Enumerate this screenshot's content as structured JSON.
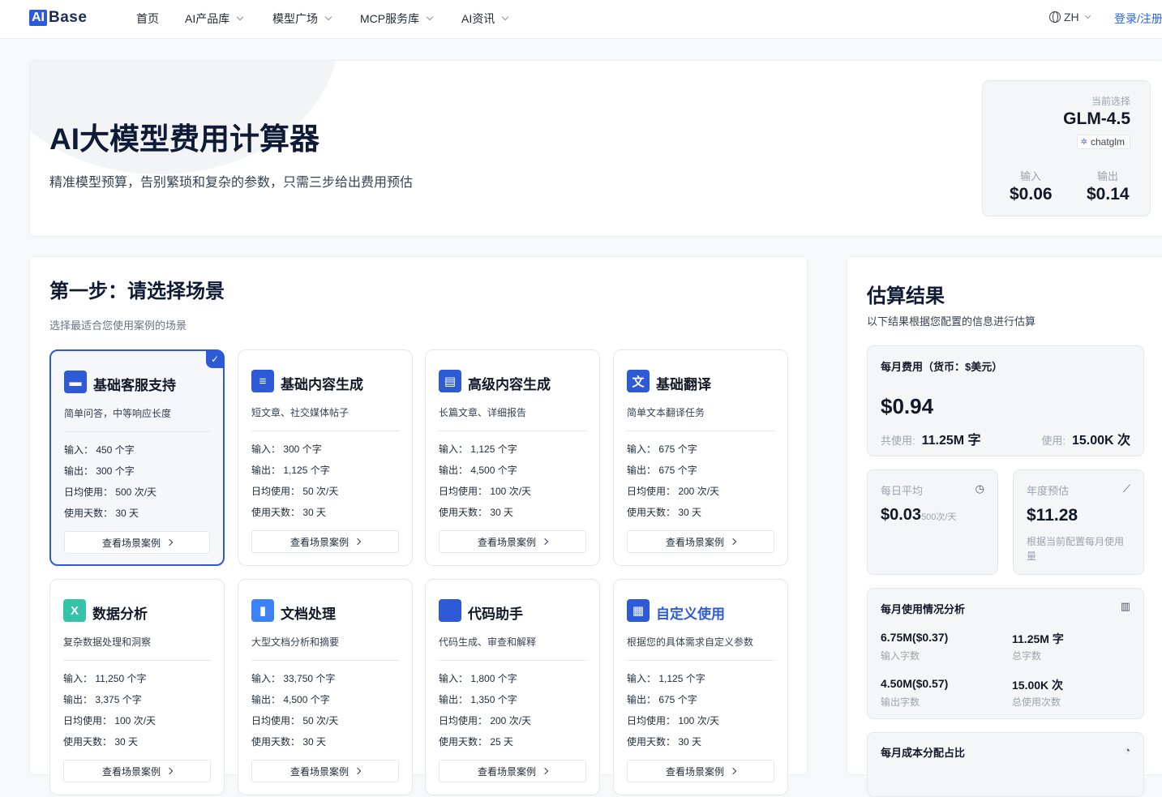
{
  "nav": {
    "logo_ai": "AI",
    "logo_base": "Base",
    "items": [
      "首页",
      "AI产品库",
      "模型广场",
      "MCP服务库",
      "AI资讯"
    ],
    "lang": "ZH",
    "login": "登录/注册"
  },
  "hero": {
    "title": "AI大模型费用计算器",
    "subtitle": "精准模型预算，告别繁琐和复杂的参数，只需三步给出费用预估"
  },
  "selection": {
    "label": "当前选择",
    "model": "GLM-4.5",
    "provider": "chatglm",
    "input_label": "输入",
    "input_price": "$0.06",
    "output_label": "输出",
    "output_price": "$0.14"
  },
  "step1": {
    "title": "第一步：请选择场景",
    "desc": "选择最适合您使用案例的场景",
    "button_label": "查看场景案例",
    "cards": [
      {
        "title": "基础客服支持",
        "desc": "简单问答，中等响应长度",
        "input": "输入： 450 个字",
        "output": "输出： 300 个字",
        "daily": "日均使用： 500 次/天",
        "days": "使用天数： 30 天",
        "selected": true,
        "icon": "chat-icon",
        "color": "#2d5bd7"
      },
      {
        "title": "基础内容生成",
        "desc": "短文章、社交媒体帖子",
        "input": "输入： 300 个字",
        "output": "输出： 1,125 个字",
        "daily": "日均使用： 50 次/天",
        "days": "使用天数： 30 天",
        "selected": false,
        "icon": "text-lines-icon",
        "color": "#2d5bd7"
      },
      {
        "title": "高级内容生成",
        "desc": "长篇文章、详细报告",
        "input": "输入： 1,125 个字",
        "output": "输出： 4,500 个字",
        "daily": "日均使用： 100 次/天",
        "days": "使用天数： 30 天",
        "selected": false,
        "icon": "document-star-icon",
        "color": "#2d5bd7"
      },
      {
        "title": "基础翻译",
        "desc": "简单文本翻译任务",
        "input": "输入： 675 个字",
        "output": "输出： 675 个字",
        "daily": "日均使用： 200 次/天",
        "days": "使用天数： 30 天",
        "selected": false,
        "icon": "translate-icon",
        "color": "#2d5bd7"
      },
      {
        "title": "数据分析",
        "desc": "复杂数据处理和洞察",
        "input": "输入： 11,250 个字",
        "output": "输出： 3,375 个字",
        "daily": "日均使用： 100 次/天",
        "days": "使用天数： 30 天",
        "selected": false,
        "icon": "excel-icon",
        "color": "#34c3a8"
      },
      {
        "title": "文档处理",
        "desc": "大型文档分析和摘要",
        "input": "输入： 33,750 个字",
        "output": "输出： 4,500 个字",
        "daily": "日均使用： 50 次/天",
        "days": "使用天数： 30 天",
        "selected": false,
        "icon": "book-icon",
        "color": "#3b82f6"
      },
      {
        "title": "代码助手",
        "desc": "代码生成、审查和解释",
        "input": "输入： 1,800 个字",
        "output": "输出： 1,350 个字",
        "daily": "日均使用： 200 次/天",
        "days": "使用天数： 25 天",
        "selected": false,
        "icon": "code-icon",
        "color": "#2d5bd7"
      },
      {
        "title": "自定义使用",
        "desc": "根据您的具体需求自定义参数",
        "input": "输入： 1,125 个字",
        "output": "输出： 675 个字",
        "daily": "日均使用： 100 次/天",
        "days": "使用天数： 30 天",
        "selected": false,
        "icon": "grid-icon",
        "color": "#2d5bd7"
      }
    ]
  },
  "result": {
    "title": "估算结果",
    "desc": "以下结果根据您配置的信息进行估算",
    "monthly_label": "每月费用（货币：$美元）",
    "monthly_cost": "$0.94",
    "total_label": "共使用:",
    "total_value": "11.25M 字",
    "usage_label": "使用:",
    "usage_value": "15.00K 次",
    "daily_label": "每日平均",
    "daily_value": "$0.03",
    "daily_unit": "500次/天",
    "yearly_label": "年度预估",
    "yearly_value": "$11.28",
    "yearly_note": "根据当前配置每月使用量",
    "analysis_title": "每月使用情况分析",
    "analysis": [
      {
        "value": "6.75M($0.37)",
        "label": "输入字数"
      },
      {
        "value": "11.25M 字",
        "label": "总字数"
      },
      {
        "value": "4.50M($0.57)",
        "label": "输出字数"
      },
      {
        "value": "15.00K 次",
        "label": "总使用次数"
      }
    ],
    "distribution_title": "每月成本分配占比"
  }
}
